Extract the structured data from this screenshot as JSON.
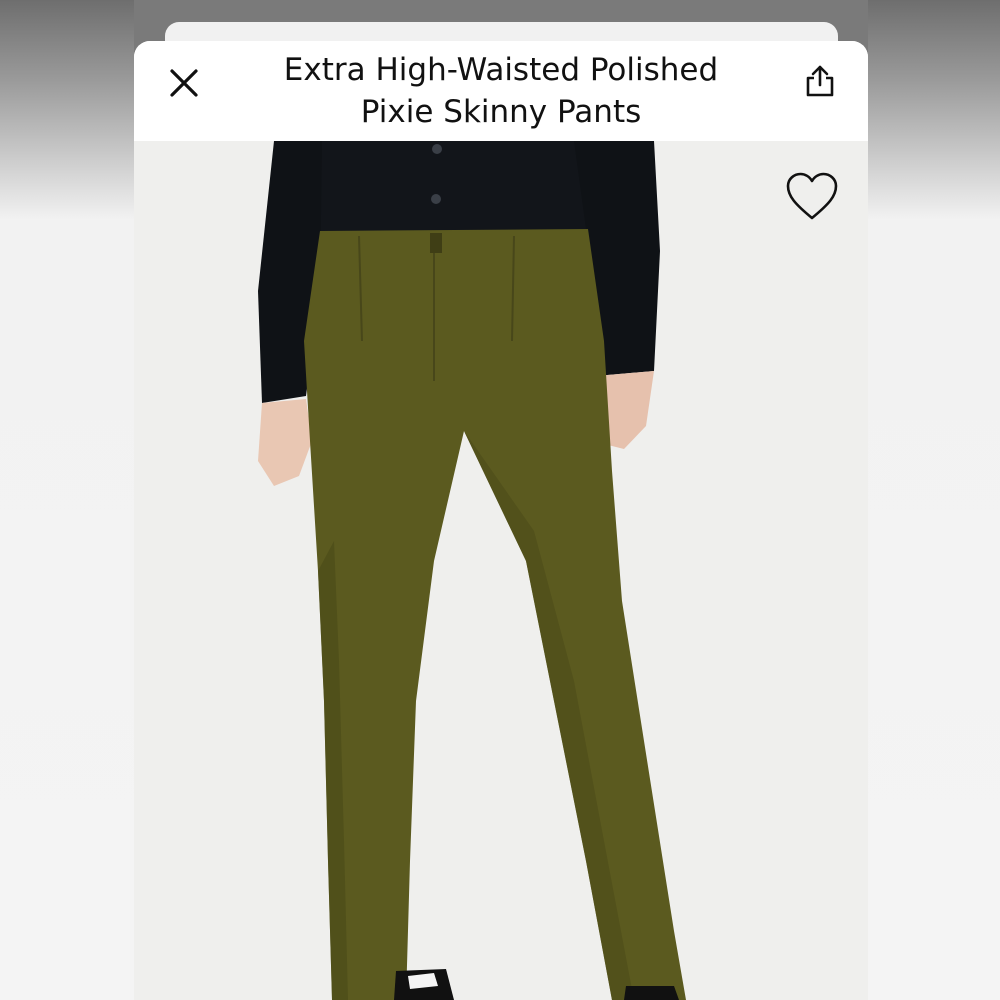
{
  "product": {
    "title_line1": "Extra High-Waisted Polished",
    "title_line2": "Pixie Skinny Pants"
  },
  "icons": {
    "close": "close-icon",
    "share": "share-icon",
    "favorite": "heart-outline-icon"
  },
  "colors": {
    "pants": "#5b5a1f",
    "cardigan": "#111418",
    "background": "#efefed"
  }
}
